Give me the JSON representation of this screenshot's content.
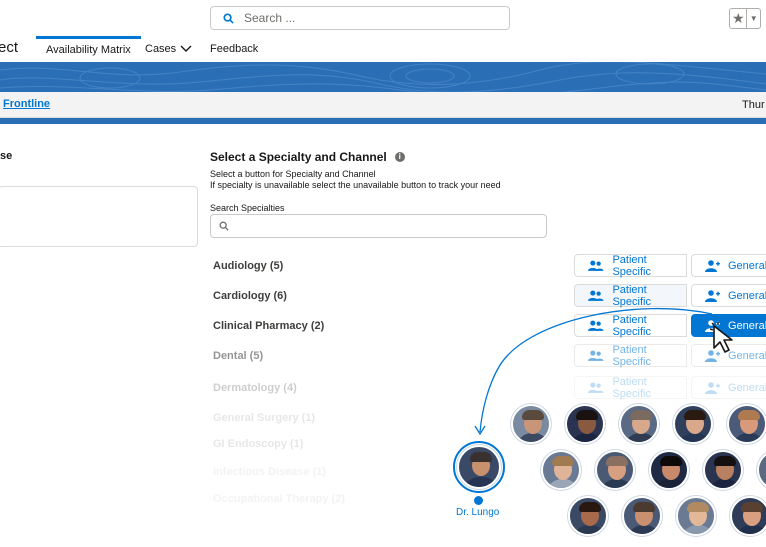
{
  "search": {
    "placeholder": "Search ..."
  },
  "nav": {
    "app_name": "ect",
    "tabs": [
      {
        "label": "Availability Matrix",
        "active": true
      },
      {
        "label": "Cases"
      },
      {
        "label": "Feedback"
      }
    ]
  },
  "subheader": {
    "link": "Frontline",
    "date": "Thur"
  },
  "left": {
    "title": "se"
  },
  "section": {
    "title": "Select a Specialty and Channel",
    "subtitle1": "Select a button for Specialty and Channel",
    "subtitle2": "If specialty is unavailable select the unavailable button to track your need",
    "search_label": "Search Specialties"
  },
  "buttons": {
    "patient_specific": "Patient Specific",
    "general": "General"
  },
  "specialties": [
    {
      "label": "Audiology (5)"
    },
    {
      "label": "Cardiology (6)"
    },
    {
      "label": "Clinical Pharmacy (2)"
    },
    {
      "label": "Dental (5)"
    },
    {
      "label": "Dermatology (4)"
    },
    {
      "label": "General Surgery (1)"
    },
    {
      "label": "GI Endoscopy (1)"
    },
    {
      "label": "Infectious Disease (1)"
    },
    {
      "label": "Occupational Therapy (2)"
    }
  ],
  "doctor": {
    "name": "Dr. Lungo"
  },
  "colors": {
    "accent": "#0176d3",
    "banner": "#2a6fb6"
  }
}
